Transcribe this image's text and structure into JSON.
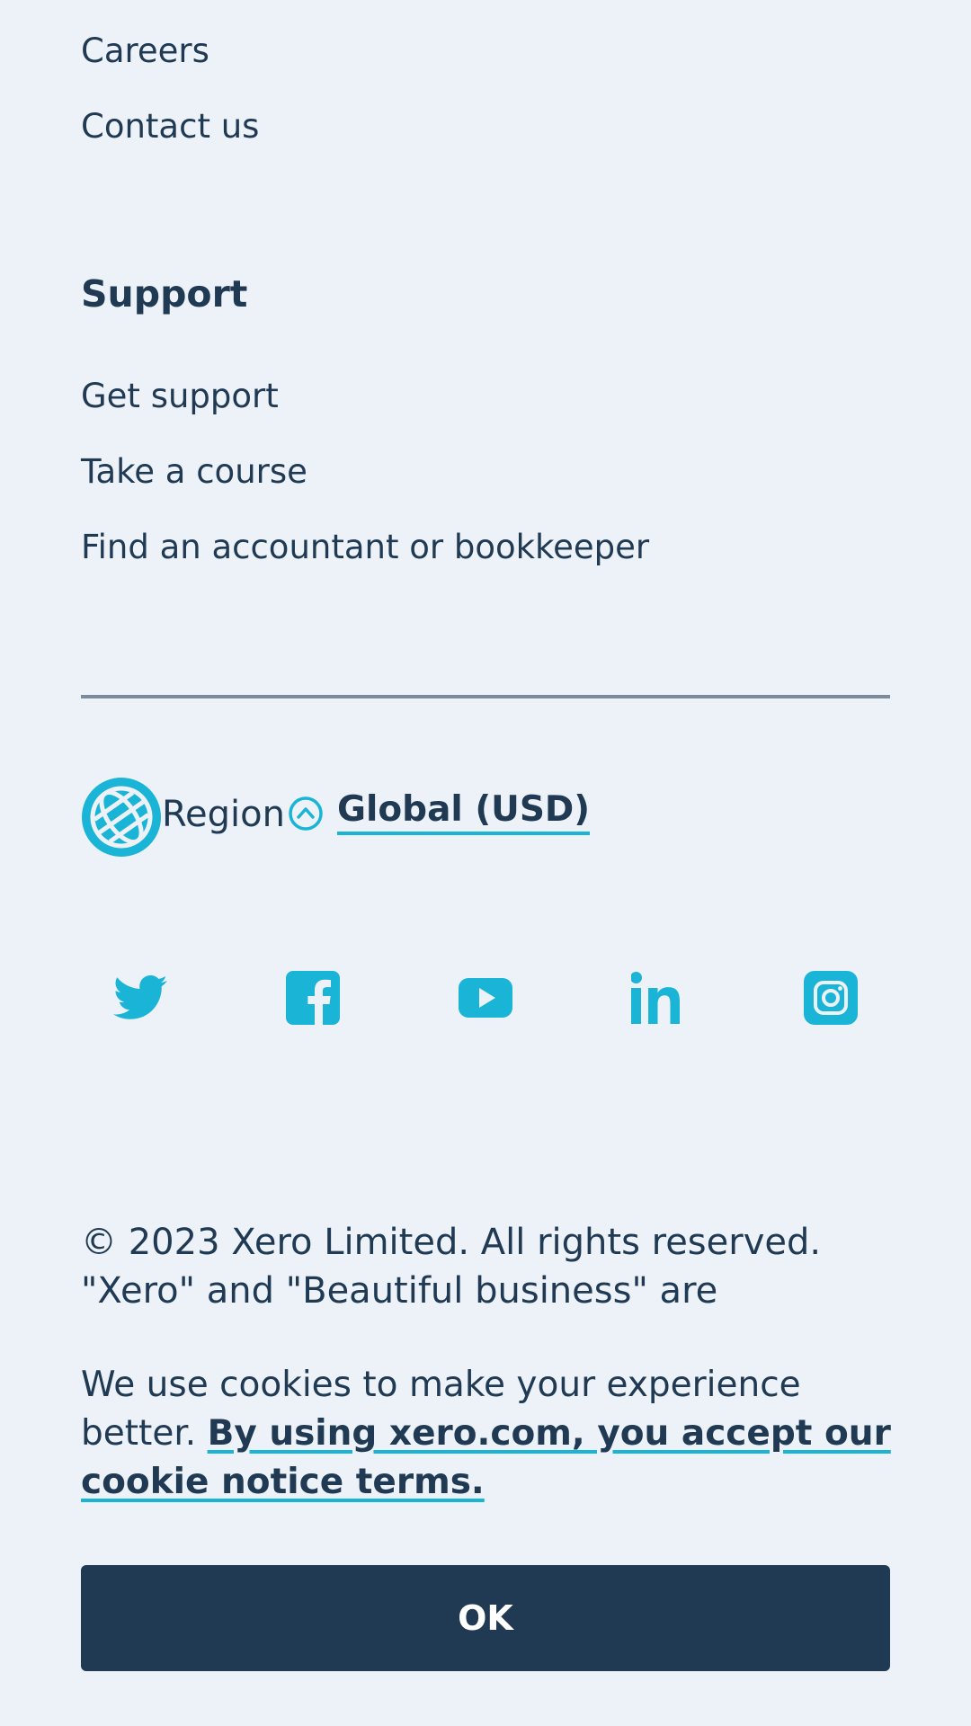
{
  "company_links": [
    "Careers",
    "Contact us"
  ],
  "support": {
    "heading": "Support",
    "links": [
      "Get support",
      "Take a course",
      "Find an accountant or bookkeeper"
    ]
  },
  "region": {
    "label": "Region",
    "selected": "Global (USD)"
  },
  "social": [
    {
      "icon": "twitter-icon",
      "color": "#1ab4d7"
    },
    {
      "icon": "facebook-icon",
      "color": "#1ab4d7"
    },
    {
      "icon": "youtube-icon",
      "color": "#1ab4d7"
    },
    {
      "icon": "linkedin-icon",
      "color": "#1ab4d7"
    },
    {
      "icon": "instagram-icon",
      "color": "#1ab4d7"
    }
  ],
  "copyright": "© 2023 Xero Limited. All rights reserved. \"Xero\" and \"Beautiful business\" are",
  "cookie": {
    "message": "We use cookies to make your experience better.",
    "link_text": "By using xero.com, you accept our cookie notice terms.",
    "ok_label": "OK"
  },
  "colors": {
    "background": "#ecf2f8",
    "text": "#213a54",
    "accent": "#1ab4d7",
    "button": "#213a54",
    "divider": "#7b8b9c"
  }
}
